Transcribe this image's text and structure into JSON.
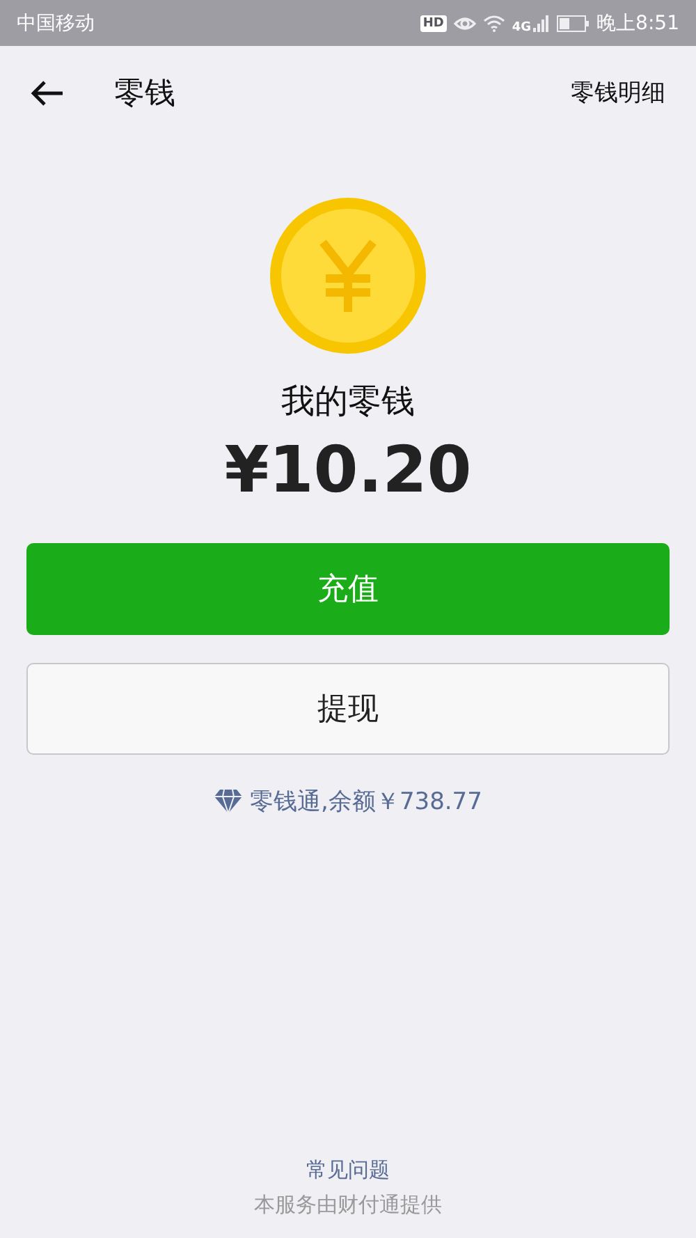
{
  "status_bar": {
    "carrier": "中国移动",
    "hd_badge": "HD",
    "network": "4G",
    "time": "晚上8:51"
  },
  "nav_bar": {
    "title": "零钱",
    "action": "零钱明细"
  },
  "balance": {
    "label": "我的零钱",
    "amount": "¥10.20"
  },
  "buttons": [
    {
      "label": "充值",
      "kind": "primary"
    },
    {
      "label": "提现",
      "kind": "secondary"
    }
  ],
  "fund_link": "零钱通,余额￥738.77",
  "footer": {
    "faq": "常见问题",
    "provider": "本服务由财付通提供"
  }
}
